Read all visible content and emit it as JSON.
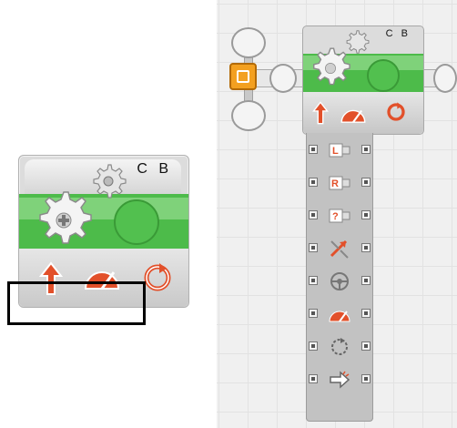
{
  "motor_block_large": {
    "ports_label": "C B",
    "properties": [
      "direction-arrow-icon",
      "power-gauge-icon",
      "duration-rotation-icon"
    ]
  },
  "motor_block_small": {
    "ports_label": "C B",
    "properties": [
      "direction-arrow-icon",
      "power-gauge-icon",
      "duration-rotation-icon"
    ]
  },
  "data_hub": {
    "plugs": [
      {
        "name": "left-motor-plug",
        "icon": "left-motor-icon",
        "glyph": "L"
      },
      {
        "name": "right-motor-plug",
        "icon": "right-motor-icon",
        "glyph": "R"
      },
      {
        "name": "other-motor-plug",
        "icon": "other-motor-icon",
        "glyph": "?"
      },
      {
        "name": "direction-plug",
        "icon": "direction-icon",
        "glyph": ""
      },
      {
        "name": "steering-plug",
        "icon": "steering-icon",
        "glyph": ""
      },
      {
        "name": "power-plug",
        "icon": "power-icon",
        "glyph": ""
      },
      {
        "name": "duration-plug",
        "icon": "duration-icon",
        "glyph": ""
      },
      {
        "name": "next-action-plug",
        "icon": "next-action-icon",
        "glyph": ""
      }
    ]
  },
  "colors": {
    "block_green": "#4dbb4a",
    "block_gray": "#dcdcdc",
    "direction_red": "#e2502a",
    "power_orange": "#e2502a",
    "sequence_orange": "#f3a020",
    "highlight": "#000000"
  }
}
